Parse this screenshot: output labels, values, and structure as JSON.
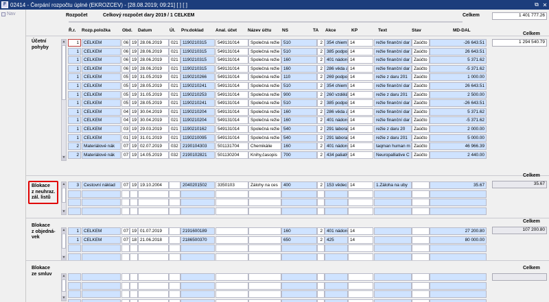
{
  "window": {
    "title": "02414 - Čerpání rozpočtu úplné (EKROZCEV) - [28.08.2019; 09:21]  [ ]  [ ]",
    "buttons": {
      "restore": "⧉",
      "close": "✕"
    }
  },
  "nav": {
    "label": "Nav"
  },
  "header": {
    "rozpocet_label": "Rozpočet",
    "rozpocet_value": "Celkový rozpočet dary 2019 / 1 CELKEM",
    "celkem_label": "Celkem",
    "celkem_value": "1 401 777.26"
  },
  "columns": {
    "rr": "Ř.r.",
    "rozp": "Rozp.položka",
    "obd": "Obd.",
    "datum": "Datum",
    "ul": "Úl.",
    "prvdoklad": "Prv.doklad",
    "anal": "Anal. účet",
    "nazev": "Název účtu",
    "ns": "NS",
    "ta": "TA",
    "akce": "Akce",
    "kp": "KP",
    "text": "Text",
    "stav": "Stav",
    "mddal": "MD-DAL"
  },
  "sections": {
    "ucetni": {
      "title_lines": [
        "Účetní",
        "pohyby"
      ],
      "celkem_label": "Celkem",
      "celkem_value": "1 294 540.79",
      "rows": [
        {
          "rr": "1",
          "rozp": "CELKEM",
          "obd": "06",
          "ul2": "19",
          "datum": "28.06.2019",
          "ul": "021",
          "prv": "1190210315",
          "anal": "549131014",
          "nazev": "Společná režie",
          "ns": "510",
          "ta": "2",
          "akce": "354 chiemi",
          "kp": "14",
          "text": "režie finanční dar",
          "stav": "Zaúčto",
          "md": "-26 643.51"
        },
        {
          "rr": "1",
          "rozp": "CELKEM",
          "obd": "06",
          "ul2": "19",
          "datum": "28.06.2019",
          "ul": "021",
          "prv": "1190210315",
          "anal": "549131014",
          "nazev": "Společná režie",
          "ns": "510",
          "ta": "2",
          "akce": "385 podpor",
          "kp": "14",
          "text": "režie finanční dar",
          "stav": "Zaúčto",
          "md": "26 643.51"
        },
        {
          "rr": "1",
          "rozp": "CELKEM",
          "obd": "06",
          "ul2": "19",
          "datum": "28.06.2019",
          "ul": "021",
          "prv": "1190210315",
          "anal": "549131014",
          "nazev": "Společná režie",
          "ns": "160",
          "ta": "2",
          "akce": "401 nádoro",
          "kp": "14",
          "text": "režie finanční dar",
          "stav": "Zaúčto",
          "md": "5 371.62"
        },
        {
          "rr": "1",
          "rozp": "CELKEM",
          "obd": "06",
          "ul2": "19",
          "datum": "28.06.2019",
          "ul": "021",
          "prv": "1190210315",
          "anal": "549131014",
          "nazev": "Společná režie",
          "ns": "160",
          "ta": "2",
          "akce": "286 věda a",
          "kp": "14",
          "text": "režie finanční dar",
          "stav": "Zaúčto",
          "md": "-5 371.62"
        },
        {
          "rr": "1",
          "rozp": "CELKEM",
          "obd": "05",
          "ul2": "19",
          "datum": "31.05.2019",
          "ul": "021",
          "prv": "1190210266",
          "anal": "549131014",
          "nazev": "Společná režie",
          "ns": "110",
          "ta": "2",
          "akce": "269 podpor",
          "kp": "14",
          "text": "režie z daru 201",
          "stav": "Zaúčto",
          "md": "1 000.00"
        },
        {
          "rr": "1",
          "rozp": "CELKEM",
          "obd": "05",
          "ul2": "19",
          "datum": "28.05.2019",
          "ul": "021",
          "prv": "1190210241",
          "anal": "549131014",
          "nazev": "Společná režie",
          "ns": "510",
          "ta": "2",
          "akce": "354 chiemi",
          "kp": "14",
          "text": "režie finanční dar",
          "stav": "Zaúčto",
          "md": "26 643.51"
        },
        {
          "rr": "1",
          "rozp": "CELKEM",
          "obd": "05",
          "ul2": "19",
          "datum": "31.05.2019",
          "ul": "021",
          "prv": "1190210253",
          "anal": "549131014",
          "nazev": "Společná režie",
          "ns": "900",
          "ta": "2",
          "akce": "260 vzdělá",
          "kp": "14",
          "text": "režie z daru 201",
          "stav": "Zaúčto",
          "md": "2 500.00"
        },
        {
          "rr": "1",
          "rozp": "CELKEM",
          "obd": "05",
          "ul2": "19",
          "datum": "28.05.2019",
          "ul": "021",
          "prv": "1190210241",
          "anal": "549131014",
          "nazev": "Společná režie",
          "ns": "510",
          "ta": "2",
          "akce": "385 podpor",
          "kp": "14",
          "text": "režie finanční dar",
          "stav": "Zaúčto",
          "md": "-26 643.51"
        },
        {
          "rr": "1",
          "rozp": "CELKEM",
          "obd": "04",
          "ul2": "19",
          "datum": "30.04.2019",
          "ul": "021",
          "prv": "1190210204",
          "anal": "549131014",
          "nazev": "Společná režie",
          "ns": "160",
          "ta": "2",
          "akce": "286 věda a",
          "kp": "14",
          "text": "režie finanční dar",
          "stav": "Zaúčto",
          "md": "5 371.62"
        },
        {
          "rr": "1",
          "rozp": "CELKEM",
          "obd": "04",
          "ul2": "19",
          "datum": "30.04.2019",
          "ul": "021",
          "prv": "1190210204",
          "anal": "549131014",
          "nazev": "Společná režie",
          "ns": "160",
          "ta": "2",
          "akce": "401 nádoro",
          "kp": "14",
          "text": "režie finanční dar",
          "stav": "Zaúčto",
          "md": "-5 371.62"
        },
        {
          "rr": "1",
          "rozp": "CELKEM",
          "obd": "03",
          "ul2": "19",
          "datum": "29.03.2019",
          "ul": "021",
          "prv": "1190210162",
          "anal": "549131014",
          "nazev": "Společná režie",
          "ns": "540",
          "ta": "2",
          "akce": "291 laborat",
          "kp": "14",
          "text": "režie z daru 20",
          "stav": "Zaúčto",
          "md": "2 000.00"
        },
        {
          "rr": "1",
          "rozp": "CELKEM",
          "obd": "01",
          "ul2": "19",
          "datum": "31.01.2019",
          "ul": "021",
          "prv": "1190210095",
          "anal": "549131014",
          "nazev": "Společná režie",
          "ns": "540",
          "ta": "2",
          "akce": "291 laborat",
          "kp": "14",
          "text": "režie z daru 201",
          "stav": "Zaúčto",
          "md": "5 000.00"
        },
        {
          "rr": "2",
          "rozp": "Materiálové nák",
          "obd": "07",
          "ul2": "19",
          "datum": "02.07.2019",
          "ul": "032",
          "prv": "2190104303",
          "anal": "501131704",
          "nazev": "Chemikálie",
          "ns": "160",
          "ta": "2",
          "akce": "401 nádoro",
          "kp": "14",
          "text": "taqman human m",
          "stav": "Zaúčto",
          "md": "46 966.39"
        },
        {
          "rr": "2",
          "rozp": "Materiálové nák",
          "obd": "07",
          "ul2": "19",
          "datum": "14.05.2019",
          "ul": "032",
          "prv": "2190102821",
          "anal": "501130204",
          "nazev": "Knihy,časopis",
          "ns": "700",
          "ta": "2",
          "akce": "434 paliativ",
          "kp": "14",
          "text": "Neuropalliative C",
          "stav": "Zaúčto",
          "md": "2 440.00"
        }
      ]
    },
    "neuhraz": {
      "title_lines": [
        "Blokace",
        "z neuhraz.",
        "zál. listů"
      ],
      "celkem_label": "Celkem",
      "celkem_value": "35.67",
      "rows": [
        {
          "rr": "3",
          "rozp": "Cestovní náklad",
          "obd": "07",
          "ul2": "19",
          "datum": "19.10.2004",
          "ul": "",
          "prv": "2040201502",
          "anal": "3350103",
          "nazev": "Zálohy na ces",
          "ns": "400",
          "ta": "2",
          "akce": "153 vědeck",
          "kp": "14",
          "text": "1.Záloha na uby",
          "stav": "",
          "md": "35.67"
        }
      ]
    },
    "objednavek": {
      "title_lines": [
        "Blokace",
        "z objedná-",
        "vek"
      ],
      "celkem_label": "Celkem",
      "celkem_value": "107 200.80",
      "rows": [
        {
          "rr": "1",
          "rozp": "CELKEM",
          "obd": "07",
          "ul2": "19",
          "datum": "01.07.2019",
          "ul": "",
          "prv": "2191600189",
          "anal": "",
          "nazev": "",
          "ns": "160",
          "ta": "2",
          "akce": "401 nádoro",
          "kp": "14",
          "text": "",
          "stav": "",
          "md": "27 200.80"
        },
        {
          "rr": "1",
          "rozp": "CELKEM",
          "obd": "07",
          "ul2": "18",
          "datum": "21.06.2018",
          "ul": "",
          "prv": "2186500370",
          "anal": "",
          "nazev": "",
          "ns": "650",
          "ta": "2",
          "akce": "425",
          "kp": "14",
          "text": "",
          "stav": "",
          "md": "80 000.00"
        }
      ]
    },
    "smluv": {
      "title_lines": [
        "Blokace",
        "ze smluv"
      ],
      "celkem_label": "Celkem",
      "celkem_value": "",
      "rows": []
    }
  }
}
